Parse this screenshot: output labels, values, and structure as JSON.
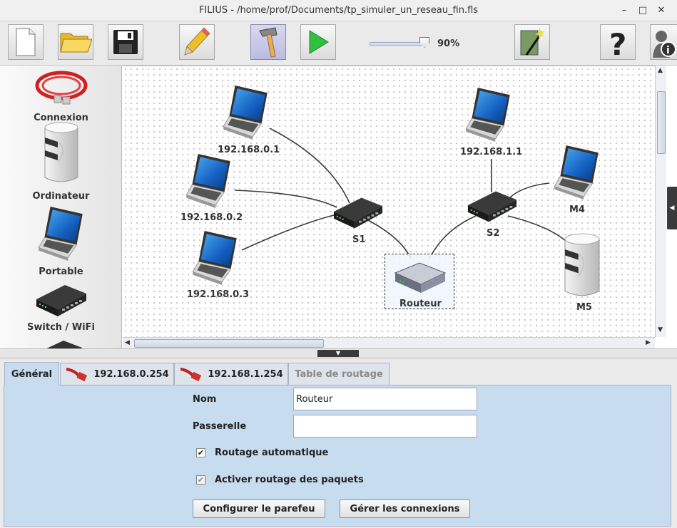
{
  "window": {
    "title": "FILIUS - /home/prof/Documents/tp_simuler_un_reseau_fin.fls"
  },
  "toolbar": {
    "zoom_label": "90%",
    "zoom_value": 0.9
  },
  "palette": [
    {
      "label": "Connexion",
      "icon": "cable-icon"
    },
    {
      "label": "Ordinateur",
      "icon": "computer-icon"
    },
    {
      "label": "Portable",
      "icon": "laptop-icon"
    },
    {
      "label": "Switch / WiFi",
      "icon": "switch-icon"
    }
  ],
  "network": {
    "nodes": [
      {
        "id": "l1",
        "type": "laptop",
        "label": "192.168.0.1"
      },
      {
        "id": "l2",
        "type": "laptop",
        "label": "192.168.0.2"
      },
      {
        "id": "l3",
        "type": "laptop",
        "label": "192.168.0.3"
      },
      {
        "id": "s1",
        "type": "switch",
        "label": "S1"
      },
      {
        "id": "r",
        "type": "router",
        "label": "Routeur"
      },
      {
        "id": "s2",
        "type": "switch",
        "label": "S2"
      },
      {
        "id": "l4",
        "type": "laptop",
        "label": "192.168.1.1"
      },
      {
        "id": "m4",
        "type": "laptop",
        "label": "M4"
      },
      {
        "id": "m5",
        "type": "computer",
        "label": "M5"
      }
    ]
  },
  "tabs": [
    {
      "label": "Général"
    },
    {
      "label": "192.168.0.254"
    },
    {
      "label": "192.168.1.254"
    },
    {
      "label": "Table de routage"
    }
  ],
  "form": {
    "name_label": "Nom",
    "name_value": "Routeur",
    "gateway_label": "Passerelle",
    "gateway_value": "",
    "auto_routing_label": "Routage automatique",
    "auto_routing_checked": true,
    "packet_routing_label": "Activer routage des paquets",
    "packet_routing_checked": true,
    "firewall_button": "Configurer le parefeu",
    "connections_button": "Gérer les connexions"
  }
}
